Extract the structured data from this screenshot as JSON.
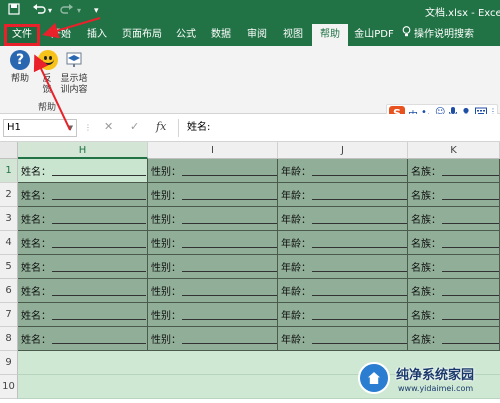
{
  "titlebar": {
    "save_icon": "save-icon",
    "undo_icon": "undo-icon",
    "redo_icon": "redo-icon",
    "customize_icon": "customize-quick-access-icon",
    "title": "文档.xlsx - Excel"
  },
  "tabs": [
    {
      "label": "文件"
    },
    {
      "label": "开始"
    },
    {
      "label": "插入"
    },
    {
      "label": "页面布局"
    },
    {
      "label": "公式"
    },
    {
      "label": "数据"
    },
    {
      "label": "审阅"
    },
    {
      "label": "视图"
    },
    {
      "label": "帮助"
    },
    {
      "label": "金山PDF"
    },
    {
      "label": "操作说明搜索"
    }
  ],
  "ribbon": {
    "help_label": "帮助",
    "feedback_label": "反馈",
    "training_label": "显示培训内容",
    "group_label": "帮助"
  },
  "ime": {
    "logo": "S",
    "mode": "中"
  },
  "formula_bar": {
    "name_box": "H1",
    "formula": "姓名:"
  },
  "grid": {
    "columns": [
      "H",
      "I",
      "J",
      "K"
    ],
    "rows": [
      "1",
      "2",
      "3",
      "4",
      "5",
      "6",
      "7",
      "8",
      "9",
      "10"
    ],
    "cell_labels": [
      "姓名：",
      "性别：",
      "年龄：",
      "名族："
    ]
  },
  "watermark": {
    "title": "纯净系统家园",
    "url": "www.yidaimei.com"
  },
  "colors": {
    "excel_green": "#217346",
    "cell_fill": "#91af98",
    "annotation_red": "#e8212a"
  }
}
